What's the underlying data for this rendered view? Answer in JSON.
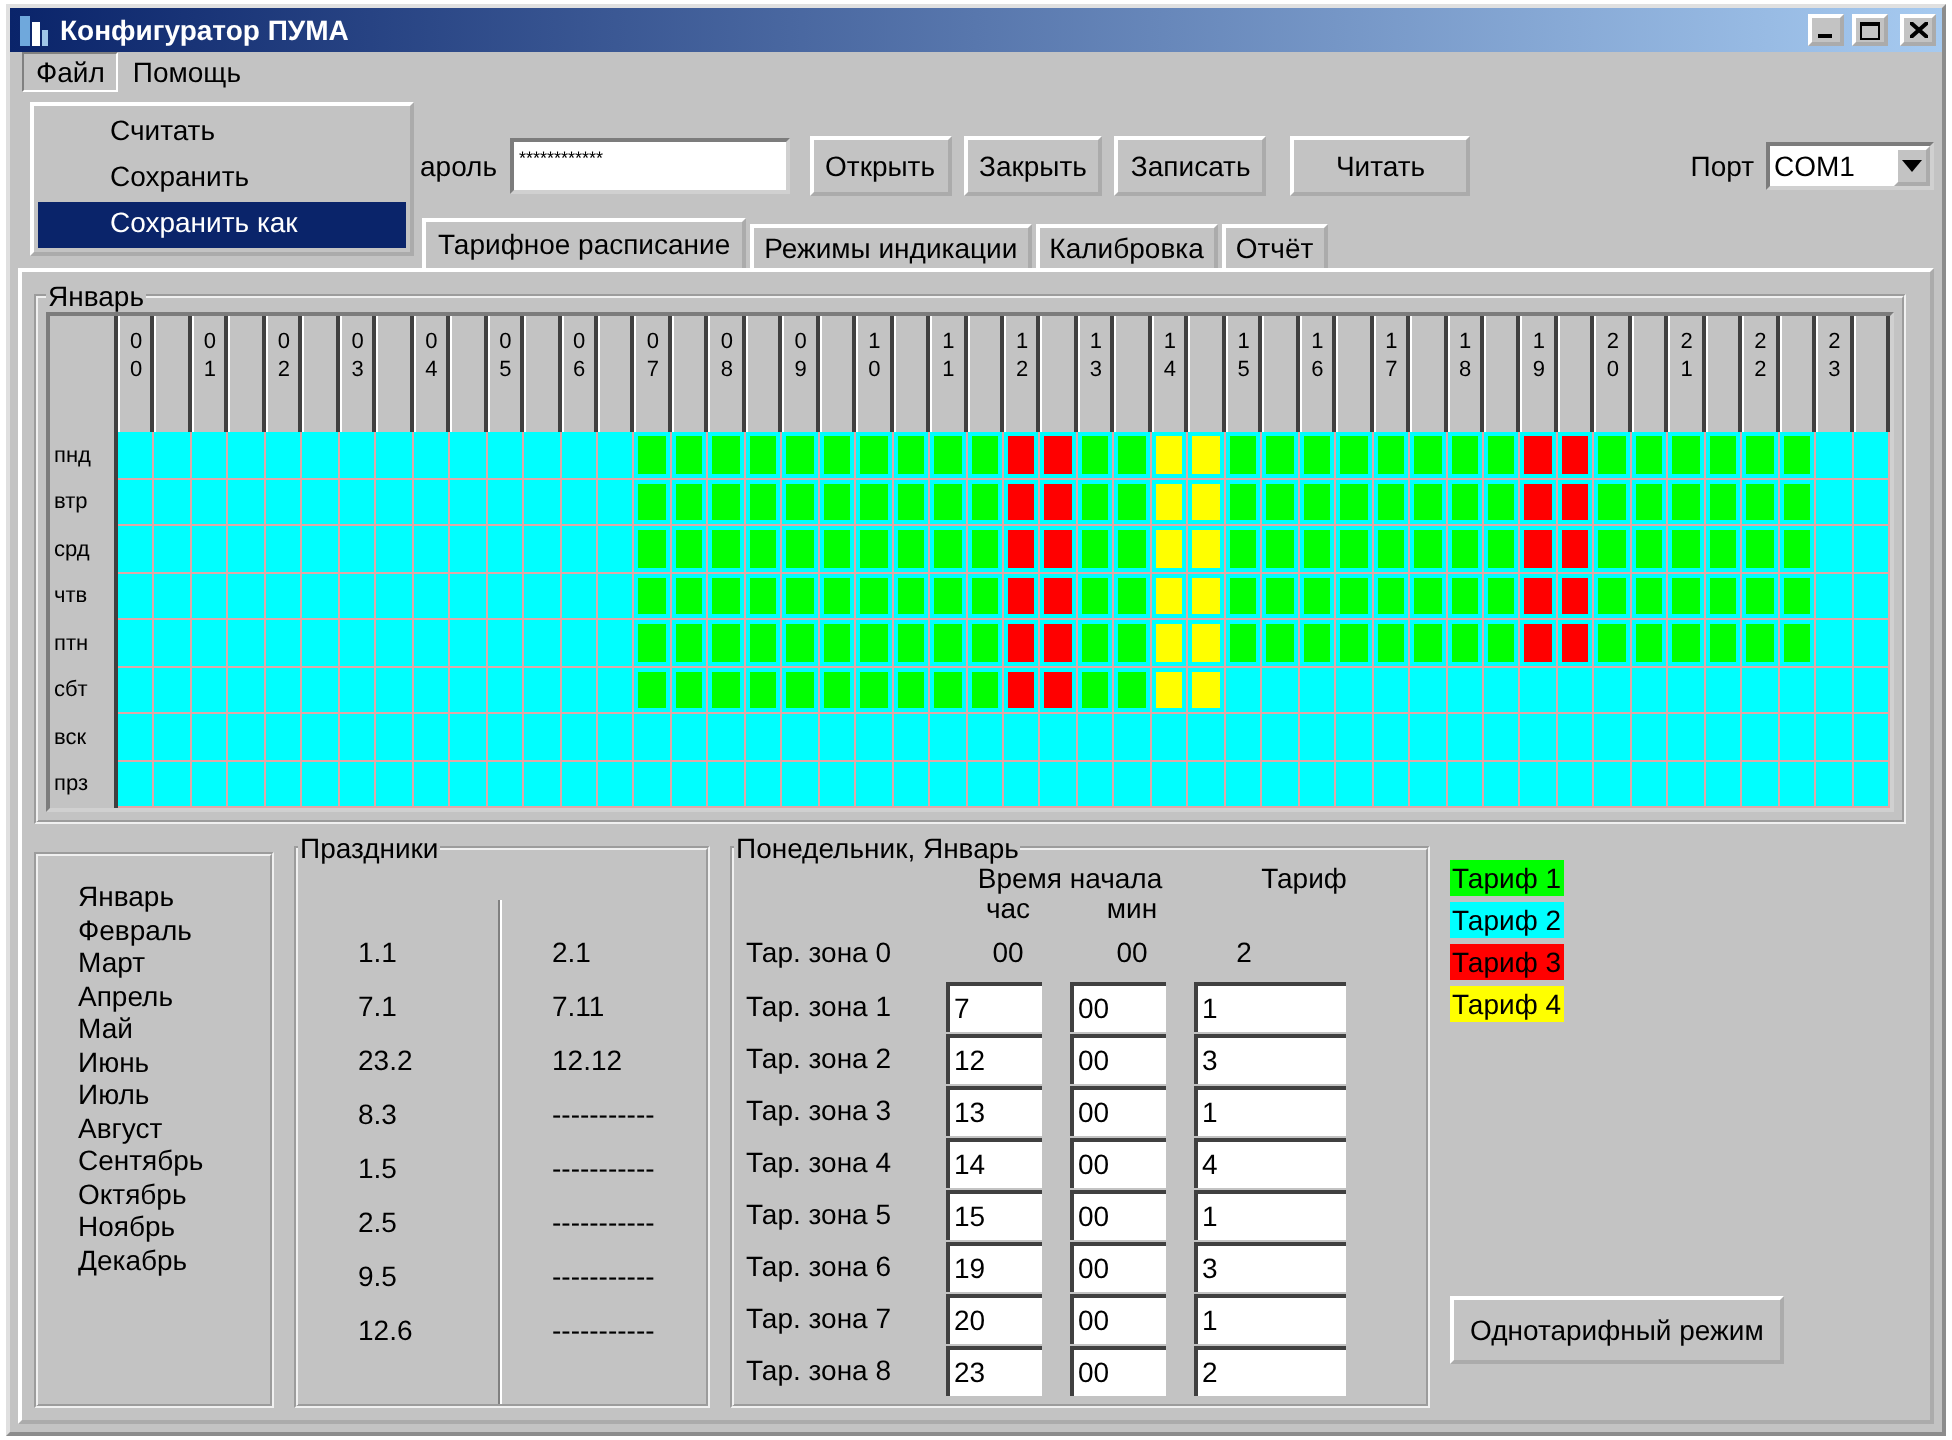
{
  "window": {
    "title": "Конфигуратор ПУМА"
  },
  "menu_bar": [
    {
      "label": "Файл",
      "selected": true
    },
    {
      "label": "Помощь",
      "selected": false
    }
  ],
  "file_menu": [
    {
      "label": "Считать",
      "selected": false
    },
    {
      "label": "Сохранить",
      "selected": false
    },
    {
      "label": "Сохранить как",
      "selected": true
    }
  ],
  "toolbar": {
    "password_label": "ароль",
    "password_value": "************",
    "buttons": [
      "Открыть",
      "Закрыть",
      "Записать",
      "Читать"
    ],
    "port_label": "Порт",
    "port_value": "COM1"
  },
  "tabs": [
    {
      "label": "Тарифное расписание",
      "selected": true
    },
    {
      "label": "Режимы индикации",
      "selected": false
    },
    {
      "label": "Калибровка",
      "selected": false
    },
    {
      "label": "Отчёт",
      "selected": false
    }
  ],
  "schedule": {
    "title": "Январь",
    "hours": [
      "00",
      "01",
      "02",
      "03",
      "04",
      "05",
      "06",
      "07",
      "08",
      "09",
      "10",
      "11",
      "12",
      "13",
      "14",
      "15",
      "16",
      "17",
      "18",
      "19",
      "20",
      "21",
      "22",
      "23"
    ],
    "days": [
      {
        "label": "пнд",
        "cells": [
          {
            "color": "#00ffff"
          },
          {
            "color": "#00ffff"
          },
          {
            "color": "#00ffff"
          },
          {
            "color": "#00ffff"
          },
          {
            "color": "#00ffff"
          },
          {
            "color": "#00ffff"
          },
          {
            "color": "#00ffff"
          },
          {
            "color": "#00ffff"
          },
          {
            "color": "#00ffff"
          },
          {
            "color": "#00ffff"
          },
          {
            "color": "#00ffff"
          },
          {
            "color": "#00ffff"
          },
          {
            "color": "#00ffff"
          },
          {
            "color": "#00ffff"
          },
          {
            "color": "#00ff00"
          },
          {
            "color": "#00ff00"
          },
          {
            "color": "#00ff00"
          },
          {
            "color": "#00ff00"
          },
          {
            "color": "#00ff00"
          },
          {
            "color": "#00ff00"
          },
          {
            "color": "#00ff00"
          },
          {
            "color": "#00ff00"
          },
          {
            "color": "#00ff00"
          },
          {
            "color": "#00ff00"
          },
          {
            "color": "#ff0000"
          },
          {
            "color": "#ff0000"
          },
          {
            "color": "#00ff00"
          },
          {
            "color": "#00ff00"
          },
          {
            "color": "#ffff00"
          },
          {
            "color": "#ffff00"
          },
          {
            "color": "#00ff00"
          },
          {
            "color": "#00ff00"
          },
          {
            "color": "#00ff00"
          },
          {
            "color": "#00ff00"
          },
          {
            "color": "#00ff00"
          },
          {
            "color": "#00ff00"
          },
          {
            "color": "#00ff00"
          },
          {
            "color": "#00ff00"
          },
          {
            "color": "#ff0000"
          },
          {
            "color": "#ff0000"
          },
          {
            "color": "#00ff00"
          },
          {
            "color": "#00ff00"
          },
          {
            "color": "#00ff00"
          },
          {
            "color": "#00ff00"
          },
          {
            "color": "#00ff00"
          },
          {
            "color": "#00ff00"
          },
          {
            "color": "#00ffff"
          },
          {
            "color": "#00ffff"
          }
        ]
      },
      {
        "label": "втр",
        "cells": [
          {
            "color": "#00ffff"
          },
          {
            "color": "#00ffff"
          },
          {
            "color": "#00ffff"
          },
          {
            "color": "#00ffff"
          },
          {
            "color": "#00ffff"
          },
          {
            "color": "#00ffff"
          },
          {
            "color": "#00ffff"
          },
          {
            "color": "#00ffff"
          },
          {
            "color": "#00ffff"
          },
          {
            "color": "#00ffff"
          },
          {
            "color": "#00ffff"
          },
          {
            "color": "#00ffff"
          },
          {
            "color": "#00ffff"
          },
          {
            "color": "#00ffff"
          },
          {
            "color": "#00ff00"
          },
          {
            "color": "#00ff00"
          },
          {
            "color": "#00ff00"
          },
          {
            "color": "#00ff00"
          },
          {
            "color": "#00ff00"
          },
          {
            "color": "#00ff00"
          },
          {
            "color": "#00ff00"
          },
          {
            "color": "#00ff00"
          },
          {
            "color": "#00ff00"
          },
          {
            "color": "#00ff00"
          },
          {
            "color": "#ff0000"
          },
          {
            "color": "#ff0000"
          },
          {
            "color": "#00ff00"
          },
          {
            "color": "#00ff00"
          },
          {
            "color": "#ffff00"
          },
          {
            "color": "#ffff00"
          },
          {
            "color": "#00ff00"
          },
          {
            "color": "#00ff00"
          },
          {
            "color": "#00ff00"
          },
          {
            "color": "#00ff00"
          },
          {
            "color": "#00ff00"
          },
          {
            "color": "#00ff00"
          },
          {
            "color": "#00ff00"
          },
          {
            "color": "#00ff00"
          },
          {
            "color": "#ff0000"
          },
          {
            "color": "#ff0000"
          },
          {
            "color": "#00ff00"
          },
          {
            "color": "#00ff00"
          },
          {
            "color": "#00ff00"
          },
          {
            "color": "#00ff00"
          },
          {
            "color": "#00ff00"
          },
          {
            "color": "#00ff00"
          },
          {
            "color": "#00ffff"
          },
          {
            "color": "#00ffff"
          }
        ]
      },
      {
        "label": "срд",
        "cells": [
          {
            "color": "#00ffff"
          },
          {
            "color": "#00ffff"
          },
          {
            "color": "#00ffff"
          },
          {
            "color": "#00ffff"
          },
          {
            "color": "#00ffff"
          },
          {
            "color": "#00ffff"
          },
          {
            "color": "#00ffff"
          },
          {
            "color": "#00ffff"
          },
          {
            "color": "#00ffff"
          },
          {
            "color": "#00ffff"
          },
          {
            "color": "#00ffff"
          },
          {
            "color": "#00ffff"
          },
          {
            "color": "#00ffff"
          },
          {
            "color": "#00ffff"
          },
          {
            "color": "#00ff00"
          },
          {
            "color": "#00ff00"
          },
          {
            "color": "#00ff00"
          },
          {
            "color": "#00ff00"
          },
          {
            "color": "#00ff00"
          },
          {
            "color": "#00ff00"
          },
          {
            "color": "#00ff00"
          },
          {
            "color": "#00ff00"
          },
          {
            "color": "#00ff00"
          },
          {
            "color": "#00ff00"
          },
          {
            "color": "#ff0000"
          },
          {
            "color": "#ff0000"
          },
          {
            "color": "#00ff00"
          },
          {
            "color": "#00ff00"
          },
          {
            "color": "#ffff00"
          },
          {
            "color": "#ffff00"
          },
          {
            "color": "#00ff00"
          },
          {
            "color": "#00ff00"
          },
          {
            "color": "#00ff00"
          },
          {
            "color": "#00ff00"
          },
          {
            "color": "#00ff00"
          },
          {
            "color": "#00ff00"
          },
          {
            "color": "#00ff00"
          },
          {
            "color": "#00ff00"
          },
          {
            "color": "#ff0000"
          },
          {
            "color": "#ff0000"
          },
          {
            "color": "#00ff00"
          },
          {
            "color": "#00ff00"
          },
          {
            "color": "#00ff00"
          },
          {
            "color": "#00ff00"
          },
          {
            "color": "#00ff00"
          },
          {
            "color": "#00ff00"
          },
          {
            "color": "#00ffff"
          },
          {
            "color": "#00ffff"
          }
        ]
      },
      {
        "label": "чтв",
        "cells": [
          {
            "color": "#00ffff"
          },
          {
            "color": "#00ffff"
          },
          {
            "color": "#00ffff"
          },
          {
            "color": "#00ffff"
          },
          {
            "color": "#00ffff"
          },
          {
            "color": "#00ffff"
          },
          {
            "color": "#00ffff"
          },
          {
            "color": "#00ffff"
          },
          {
            "color": "#00ffff"
          },
          {
            "color": "#00ffff"
          },
          {
            "color": "#00ffff"
          },
          {
            "color": "#00ffff"
          },
          {
            "color": "#00ffff"
          },
          {
            "color": "#00ffff"
          },
          {
            "color": "#00ff00"
          },
          {
            "color": "#00ff00"
          },
          {
            "color": "#00ff00"
          },
          {
            "color": "#00ff00"
          },
          {
            "color": "#00ff00"
          },
          {
            "color": "#00ff00"
          },
          {
            "color": "#00ff00"
          },
          {
            "color": "#00ff00"
          },
          {
            "color": "#00ff00"
          },
          {
            "color": "#00ff00"
          },
          {
            "color": "#ff0000"
          },
          {
            "color": "#ff0000"
          },
          {
            "color": "#00ff00"
          },
          {
            "color": "#00ff00"
          },
          {
            "color": "#ffff00"
          },
          {
            "color": "#ffff00"
          },
          {
            "color": "#00ff00"
          },
          {
            "color": "#00ff00"
          },
          {
            "color": "#00ff00"
          },
          {
            "color": "#00ff00"
          },
          {
            "color": "#00ff00"
          },
          {
            "color": "#00ff00"
          },
          {
            "color": "#00ff00"
          },
          {
            "color": "#00ff00"
          },
          {
            "color": "#ff0000"
          },
          {
            "color": "#ff0000"
          },
          {
            "color": "#00ff00"
          },
          {
            "color": "#00ff00"
          },
          {
            "color": "#00ff00"
          },
          {
            "color": "#00ff00"
          },
          {
            "color": "#00ff00"
          },
          {
            "color": "#00ff00"
          },
          {
            "color": "#00ffff"
          },
          {
            "color": "#00ffff"
          }
        ]
      },
      {
        "label": "птн",
        "cells": [
          {
            "color": "#00ffff"
          },
          {
            "color": "#00ffff"
          },
          {
            "color": "#00ffff"
          },
          {
            "color": "#00ffff"
          },
          {
            "color": "#00ffff"
          },
          {
            "color": "#00ffff"
          },
          {
            "color": "#00ffff"
          },
          {
            "color": "#00ffff"
          },
          {
            "color": "#00ffff"
          },
          {
            "color": "#00ffff"
          },
          {
            "color": "#00ffff"
          },
          {
            "color": "#00ffff"
          },
          {
            "color": "#00ffff"
          },
          {
            "color": "#00ffff"
          },
          {
            "color": "#00ff00"
          },
          {
            "color": "#00ff00"
          },
          {
            "color": "#00ff00"
          },
          {
            "color": "#00ff00"
          },
          {
            "color": "#00ff00"
          },
          {
            "color": "#00ff00"
          },
          {
            "color": "#00ff00"
          },
          {
            "color": "#00ff00"
          },
          {
            "color": "#00ff00"
          },
          {
            "color": "#00ff00"
          },
          {
            "color": "#ff0000"
          },
          {
            "color": "#ff0000"
          },
          {
            "color": "#00ff00"
          },
          {
            "color": "#00ff00"
          },
          {
            "color": "#ffff00"
          },
          {
            "color": "#ffff00"
          },
          {
            "color": "#00ff00"
          },
          {
            "color": "#00ff00"
          },
          {
            "color": "#00ff00"
          },
          {
            "color": "#00ff00"
          },
          {
            "color": "#00ff00"
          },
          {
            "color": "#00ff00"
          },
          {
            "color": "#00ff00"
          },
          {
            "color": "#00ff00"
          },
          {
            "color": "#ff0000"
          },
          {
            "color": "#ff0000"
          },
          {
            "color": "#00ff00"
          },
          {
            "color": "#00ff00"
          },
          {
            "color": "#00ff00"
          },
          {
            "color": "#00ff00"
          },
          {
            "color": "#00ff00"
          },
          {
            "color": "#00ff00"
          },
          {
            "color": "#00ffff"
          },
          {
            "color": "#00ffff"
          }
        ]
      },
      {
        "label": "сбт",
        "cells": [
          {
            "color": "#00ffff"
          },
          {
            "color": "#00ffff"
          },
          {
            "color": "#00ffff"
          },
          {
            "color": "#00ffff"
          },
          {
            "color": "#00ffff"
          },
          {
            "color": "#00ffff"
          },
          {
            "color": "#00ffff"
          },
          {
            "color": "#00ffff"
          },
          {
            "color": "#00ffff"
          },
          {
            "color": "#00ffff"
          },
          {
            "color": "#00ffff"
          },
          {
            "color": "#00ffff"
          },
          {
            "color": "#00ffff"
          },
          {
            "color": "#00ffff"
          },
          {
            "color": "#00ff00"
          },
          {
            "color": "#00ff00"
          },
          {
            "color": "#00ff00"
          },
          {
            "color": "#00ff00"
          },
          {
            "color": "#00ff00"
          },
          {
            "color": "#00ff00"
          },
          {
            "color": "#00ff00"
          },
          {
            "color": "#00ff00"
          },
          {
            "color": "#00ff00"
          },
          {
            "color": "#00ff00"
          },
          {
            "color": "#ff0000"
          },
          {
            "color": "#ff0000"
          },
          {
            "color": "#00ff00"
          },
          {
            "color": "#00ff00"
          },
          {
            "color": "#ffff00"
          },
          {
            "color": "#ffff00"
          },
          {
            "color": "#00ffff"
          },
          {
            "color": "#00ffff"
          },
          {
            "color": "#00ffff"
          },
          {
            "color": "#00ffff"
          },
          {
            "color": "#00ffff"
          },
          {
            "color": "#00ffff"
          },
          {
            "color": "#00ffff"
          },
          {
            "color": "#00ffff"
          },
          {
            "color": "#00ffff"
          },
          {
            "color": "#00ffff"
          },
          {
            "color": "#00ffff"
          },
          {
            "color": "#00ffff"
          },
          {
            "color": "#00ffff"
          },
          {
            "color": "#00ffff"
          },
          {
            "color": "#00ffff"
          },
          {
            "color": "#00ffff"
          },
          {
            "color": "#00ffff"
          },
          {
            "color": "#00ffff"
          }
        ]
      },
      {
        "label": "вск",
        "cells": [
          {
            "color": "#00ffff"
          },
          {
            "color": "#00ffff"
          },
          {
            "color": "#00ffff"
          },
          {
            "color": "#00ffff"
          },
          {
            "color": "#00ffff"
          },
          {
            "color": "#00ffff"
          },
          {
            "color": "#00ffff"
          },
          {
            "color": "#00ffff"
          },
          {
            "color": "#00ffff"
          },
          {
            "color": "#00ffff"
          },
          {
            "color": "#00ffff"
          },
          {
            "color": "#00ffff"
          },
          {
            "color": "#00ffff"
          },
          {
            "color": "#00ffff"
          },
          {
            "color": "#00ffff"
          },
          {
            "color": "#00ffff"
          },
          {
            "color": "#00ffff"
          },
          {
            "color": "#00ffff"
          },
          {
            "color": "#00ffff"
          },
          {
            "color": "#00ffff"
          },
          {
            "color": "#00ffff"
          },
          {
            "color": "#00ffff"
          },
          {
            "color": "#00ffff"
          },
          {
            "color": "#00ffff"
          },
          {
            "color": "#00ffff"
          },
          {
            "color": "#00ffff"
          },
          {
            "color": "#00ffff"
          },
          {
            "color": "#00ffff"
          },
          {
            "color": "#00ffff"
          },
          {
            "color": "#00ffff"
          },
          {
            "color": "#00ffff"
          },
          {
            "color": "#00ffff"
          },
          {
            "color": "#00ffff"
          },
          {
            "color": "#00ffff"
          },
          {
            "color": "#00ffff"
          },
          {
            "color": "#00ffff"
          },
          {
            "color": "#00ffff"
          },
          {
            "color": "#00ffff"
          },
          {
            "color": "#00ffff"
          },
          {
            "color": "#00ffff"
          },
          {
            "color": "#00ffff"
          },
          {
            "color": "#00ffff"
          },
          {
            "color": "#00ffff"
          },
          {
            "color": "#00ffff"
          },
          {
            "color": "#00ffff"
          },
          {
            "color": "#00ffff"
          },
          {
            "color": "#00ffff"
          },
          {
            "color": "#00ffff"
          }
        ]
      },
      {
        "label": "прз",
        "cells": [
          {
            "color": "#00ffff"
          },
          {
            "color": "#00ffff"
          },
          {
            "color": "#00ffff"
          },
          {
            "color": "#00ffff"
          },
          {
            "color": "#00ffff"
          },
          {
            "color": "#00ffff"
          },
          {
            "color": "#00ffff"
          },
          {
            "color": "#00ffff"
          },
          {
            "color": "#00ffff"
          },
          {
            "color": "#00ffff"
          },
          {
            "color": "#00ffff"
          },
          {
            "color": "#00ffff"
          },
          {
            "color": "#00ffff"
          },
          {
            "color": "#00ffff"
          },
          {
            "color": "#00ffff"
          },
          {
            "color": "#00ffff"
          },
          {
            "color": "#00ffff"
          },
          {
            "color": "#00ffff"
          },
          {
            "color": "#00ffff"
          },
          {
            "color": "#00ffff"
          },
          {
            "color": "#00ffff"
          },
          {
            "color": "#00ffff"
          },
          {
            "color": "#00ffff"
          },
          {
            "color": "#00ffff"
          },
          {
            "color": "#00ffff"
          },
          {
            "color": "#00ffff"
          },
          {
            "color": "#00ffff"
          },
          {
            "color": "#00ffff"
          },
          {
            "color": "#00ffff"
          },
          {
            "color": "#00ffff"
          },
          {
            "color": "#00ffff"
          },
          {
            "color": "#00ffff"
          },
          {
            "color": "#00ffff"
          },
          {
            "color": "#00ffff"
          },
          {
            "color": "#00ffff"
          },
          {
            "color": "#00ffff"
          },
          {
            "color": "#00ffff"
          },
          {
            "color": "#00ffff"
          },
          {
            "color": "#00ffff"
          },
          {
            "color": "#00ffff"
          },
          {
            "color": "#00ffff"
          },
          {
            "color": "#00ffff"
          },
          {
            "color": "#00ffff"
          },
          {
            "color": "#00ffff"
          },
          {
            "color": "#00ffff"
          },
          {
            "color": "#00ffff"
          },
          {
            "color": "#00ffff"
          },
          {
            "color": "#00ffff"
          }
        ]
      }
    ]
  },
  "months": [
    "Январь",
    "Февраль",
    "Март",
    "Апрель",
    "Май",
    "Июнь",
    "Июль",
    "Август",
    "Сентябрь",
    "Октябрь",
    "Ноябрь",
    "Декабрь"
  ],
  "holidays": {
    "title": "Праздники",
    "column_1": [
      "1.1",
      "7.1",
      "23.2",
      "8.3",
      "1.5",
      "2.5",
      "9.5",
      "12.6"
    ],
    "column_2": [
      "2.1",
      "7.11",
      "12.12",
      "-----------",
      "-----------",
      "-----------",
      "-----------",
      "-----------"
    ]
  },
  "zones": {
    "title": "Понедельник, Январь",
    "start_label": "Время начала",
    "hour_label": "час",
    "minute_label": "мин",
    "tariff_label": "Тариф",
    "rows": [
      {
        "kind": "text",
        "label": "Тар. зона 0",
        "hour": "00",
        "minute": "00",
        "tariff": "2"
      },
      {
        "kind": "input",
        "label": "Тар. зона 1",
        "hour": "7",
        "minute": "00",
        "tariff": "1"
      },
      {
        "kind": "input",
        "label": "Тар. зона 2",
        "hour": "12",
        "minute": "00",
        "tariff": "3"
      },
      {
        "kind": "input",
        "label": "Тар. зона 3",
        "hour": "13",
        "minute": "00",
        "tariff": "1"
      },
      {
        "kind": "input",
        "label": "Тар. зона 4",
        "hour": "14",
        "minute": "00",
        "tariff": "4"
      },
      {
        "kind": "input",
        "label": "Тар. зона 5",
        "hour": "15",
        "minute": "00",
        "tariff": "1"
      },
      {
        "kind": "input",
        "label": "Тар. зона 6",
        "hour": "19",
        "minute": "00",
        "tariff": "3"
      },
      {
        "kind": "input",
        "label": "Тар. зона 7",
        "hour": "20",
        "minute": "00",
        "tariff": "1"
      },
      {
        "kind": "input",
        "label": "Тар. зона 8",
        "hour": "23",
        "minute": "00",
        "tariff": "2"
      }
    ]
  },
  "tariffs": [
    {
      "label": "Тариф 1",
      "color": "#00ff00"
    },
    {
      "label": "Тариф 2",
      "color": "#00ffff"
    },
    {
      "label": "Тариф 3",
      "color": "#ff0000"
    },
    {
      "label": "Тариф 4",
      "color": "#ffff00"
    }
  ],
  "single_tariff_button": "Однотарифный режим"
}
